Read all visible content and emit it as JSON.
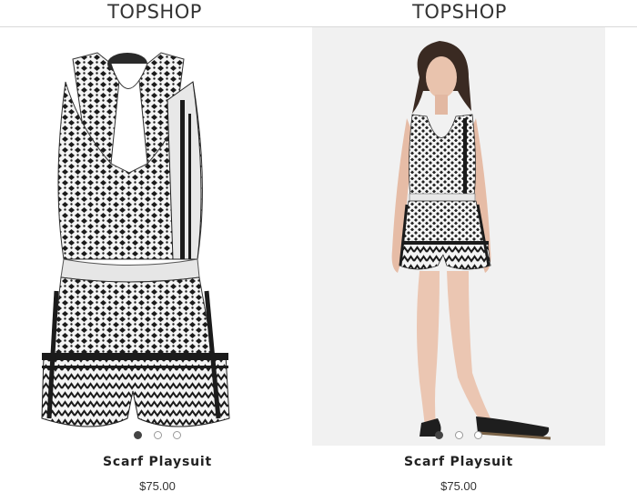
{
  "products": [
    {
      "brand": "TOPSHOP",
      "title": "Scarf Playsuit",
      "price": "$75.00",
      "image": "playsuit-flat-product-image",
      "carousel": {
        "count": 3,
        "active": 0
      }
    },
    {
      "brand": "TOPSHOP",
      "title": "Scarf Playsuit",
      "price": "$75.00",
      "image": "playsuit-model-product-image",
      "carousel": {
        "count": 3,
        "active": 0
      }
    }
  ]
}
